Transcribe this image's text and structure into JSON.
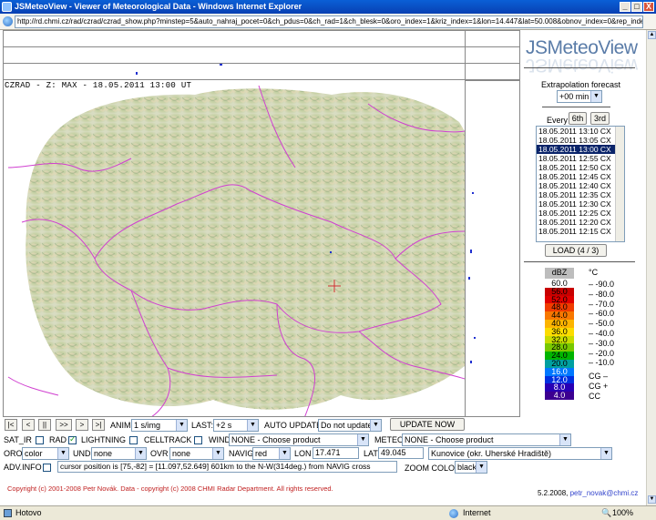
{
  "window": {
    "title": "JSMeteoView - Viewer of Meteorological Data - Windows Internet Explorer",
    "min_label": "_",
    "max_label": "□",
    "close_label": "X"
  },
  "address": {
    "url": "http://rd.chmi.cz/rad/czrad/czrad_show.php?minstep=5&auto_nahraj_pocet=0&ch_pdus=0&ch_rad=1&ch_blesk=0&oro_index=1&kriz_index=1&lon=14.447&lat=50.008&obnov_index=0&rep_index=4&"
  },
  "map": {
    "label": "CZRAD - Z: MAX - 18.05.2011 13:00 UT"
  },
  "panel": {
    "logo": "JSMeteoView",
    "extrapolation_label": "Extrapolation forecast",
    "extrapolation_value": "+00 min",
    "every_label": "Every",
    "sixth_label": "6th",
    "third_label": "3rd",
    "times": [
      "18.05.2011 13:10 CX",
      "18.05.2011 13:05 CX",
      "18.05.2011 13:00 CX",
      "18.05.2011 12:55 CX",
      "18.05.2011 12:50 CX",
      "18.05.2011 12:45 CX",
      "18.05.2011 12:40 CX",
      "18.05.2011 12:35 CX",
      "18.05.2011 12:30 CX",
      "18.05.2011 12:25 CX",
      "18.05.2011 12:20 CX",
      "18.05.2011 12:15 CX"
    ],
    "selected_time_index": 2,
    "load_label": "LOAD (4 / 3)"
  },
  "legend": {
    "dbz_title": "dBZ",
    "temp_title": "°C",
    "dbz": [
      {
        "label": "60.0",
        "color": "#ffffff"
      },
      {
        "label": "56.0",
        "color": "#c80000"
      },
      {
        "label": "52.0",
        "color": "#e00000"
      },
      {
        "label": "48.0",
        "color": "#f03c00"
      },
      {
        "label": "44.0",
        "color": "#f87800"
      },
      {
        "label": "40.0",
        "color": "#fcb400"
      },
      {
        "label": "36.0",
        "color": "#fcdc00"
      },
      {
        "label": "32.0",
        "color": "#c8dc00"
      },
      {
        "label": "28.0",
        "color": "#78c800"
      },
      {
        "label": "24.0",
        "color": "#00b400"
      },
      {
        "label": "20.0",
        "color": "#00a0a0"
      },
      {
        "label": "16.0",
        "color": "#0078ff"
      },
      {
        "label": "12.0",
        "color": "#0030e0"
      },
      {
        "label": "8.0",
        "color": "#2800b4"
      },
      {
        "label": "4.0",
        "color": "#3c0090"
      }
    ],
    "temps": [
      "-90.0",
      "-80.0",
      "-70.0",
      "-60.0",
      "-50.0",
      "-40.0",
      "-30.0",
      "-20.0",
      "-10.0"
    ],
    "cg_minus": "CG –",
    "cg_plus": "CG +",
    "cc": "CC"
  },
  "controls": {
    "nav": [
      "|<",
      "<",
      "||",
      ">>",
      ">",
      ">|"
    ],
    "anim_label": "ANIM:",
    "anim_value": "1 s/img",
    "last_label": "LAST:",
    "last_value": "+2 s",
    "auto_update_label": "AUTO UPDATE",
    "auto_update_value": "Do not update",
    "update_now": "UPDATE NOW",
    "sat_ir": "SAT_IR",
    "rad": "RAD",
    "lightning": "LIGHTNING",
    "celltrack": "CELLTRACK",
    "wind_label": "WIND",
    "wind_value": "NONE - Choose product",
    "meteo_label": "METEO",
    "meteo_value": "NONE - Choose product",
    "oro_label": "ORO",
    "oro_value": "color",
    "und_label": "UND",
    "und_value": "none",
    "ovr_label": "OVR",
    "ovr_value": "none",
    "navig_label": "NAVIG",
    "navig_value": "red",
    "lon_label": "LON",
    "lon_value": "17.471",
    "lat_label": "LAT",
    "lat_value": "49.045",
    "place_value": "Kunovice (okr. Uherské Hradiště)",
    "adv_label": "ADV.INFO",
    "cursor_info": "cursor position is [75,-82] = [11.097,52.649]  601km to the N-W(314deg.) from NAVIG cross",
    "zoom_label": "ZOOM COLOR",
    "zoom_value": "black"
  },
  "footer": {
    "copyright": "Copyright (c) 2001-2008 Petr Novák. Data - copyright (c) 2008 CHMI Radar Department. All rights reserved.",
    "date": "5.2.2008,",
    "email": "petr_novak@chmi.cz"
  },
  "status": {
    "left": "Hotovo",
    "zone": "Internet",
    "zoom": "100%"
  }
}
